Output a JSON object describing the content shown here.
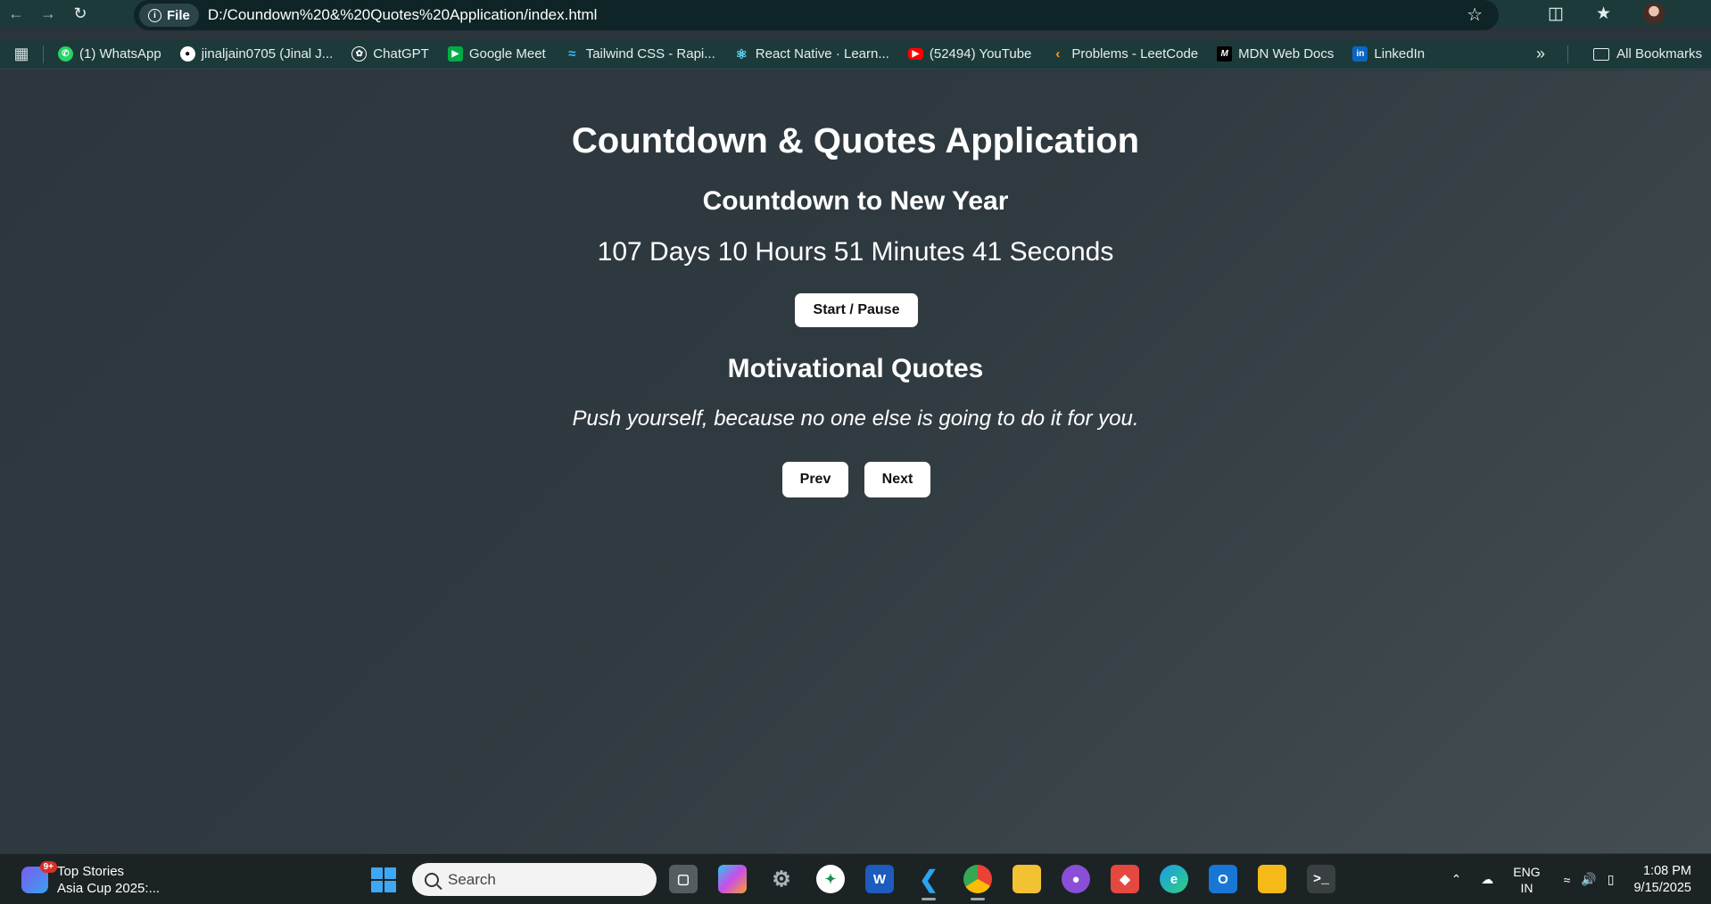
{
  "browser": {
    "file_label": "File",
    "url": "D:/Coundown%20&%20Quotes%20Application/index.html",
    "bookmarks": [
      {
        "label": "(1) WhatsApp",
        "icon": "whatsapp-icon",
        "color": "#25d366"
      },
      {
        "label": "jinaljain0705 (Jinal J...",
        "icon": "github-icon",
        "color": "#ffffff"
      },
      {
        "label": "ChatGPT",
        "icon": "chatgpt-icon",
        "color": "#ffffff"
      },
      {
        "label": "Google Meet",
        "icon": "google-meet-icon",
        "color": "#00ac47"
      },
      {
        "label": "Tailwind CSS - Rapi...",
        "icon": "tailwind-icon",
        "color": "#38bdf8"
      },
      {
        "label": "React Native · Learn...",
        "icon": "react-icon",
        "color": "#61dafb"
      },
      {
        "label": "(52494) YouTube",
        "icon": "youtube-icon",
        "color": "#ff0000"
      },
      {
        "label": "Problems - LeetCode",
        "icon": "leetcode-icon",
        "color": "#ffa116"
      },
      {
        "label": "MDN Web Docs",
        "icon": "mdn-icon",
        "color": "#000000"
      },
      {
        "label": "LinkedIn",
        "icon": "linkedin-icon",
        "color": "#0a66c2"
      }
    ],
    "all_bookmarks": "All Bookmarks"
  },
  "page": {
    "title": "Countdown & Quotes Application",
    "countdown_heading": "Countdown to New Year",
    "countdown_text": "107 Days 10 Hours 51 Minutes 41 Seconds",
    "start_pause_label": "Start / Pause",
    "quotes_heading": "Motivational Quotes",
    "quote_text": "Push yourself, because no one else is going to do it for you.",
    "prev_label": "Prev",
    "next_label": "Next"
  },
  "taskbar": {
    "widget_badge": "9+",
    "widget_title": "Top Stories",
    "widget_subtitle": "Asia Cup 2025:...",
    "search_placeholder": "Search",
    "lang_line1": "ENG",
    "lang_line2": "IN",
    "time": "1:08 PM",
    "date": "9/15/2025"
  }
}
